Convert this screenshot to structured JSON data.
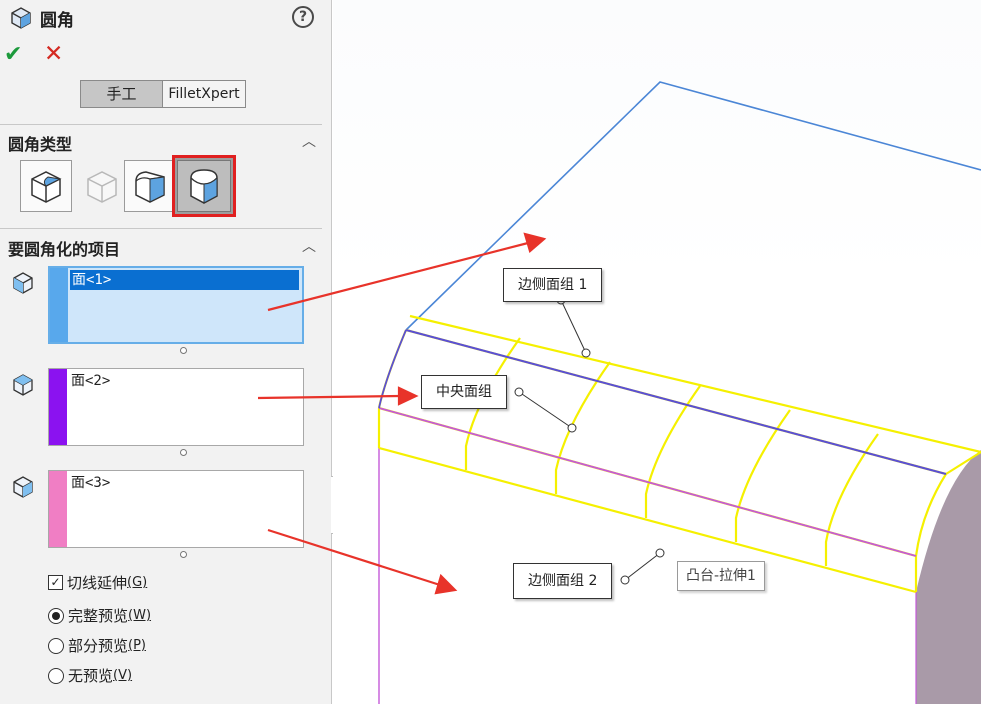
{
  "header": {
    "title": "圆角",
    "help_glyph": "?"
  },
  "actions": {
    "ok_glyph": "✔",
    "cancel_glyph": "✕"
  },
  "tabs": [
    {
      "label": "手工",
      "selected": true
    },
    {
      "label": "FilletXpert",
      "selected": false
    }
  ],
  "fillet_type": {
    "title": "圆角类型",
    "collapse_glyph": "︿",
    "options": [
      {
        "name": "constant-size-fillet",
        "selected": false
      },
      {
        "name": "variable-size-fillet",
        "selected": false,
        "disabled": true
      },
      {
        "name": "face-fillet",
        "selected": false
      },
      {
        "name": "full-round-fillet",
        "selected": true
      }
    ]
  },
  "items": {
    "title": "要圆角化的项目",
    "collapse_glyph": "︿",
    "selections": [
      {
        "value": "面<1>",
        "color": "#58a8ec",
        "active": true
      },
      {
        "value": "面<2>",
        "color": "#8b12f0",
        "active": false
      },
      {
        "value": "面<3>",
        "color": "#f07ec4",
        "active": false
      }
    ]
  },
  "options": {
    "tangent_propagation": {
      "label": "切线延伸",
      "hotkey": "(G)",
      "checked": true,
      "check_glyph": "✓"
    },
    "preview_modes": [
      {
        "label": "完整预览",
        "hotkey": "(W)",
        "selected": true
      },
      {
        "label": "部分预览",
        "hotkey": "(P)",
        "selected": false
      },
      {
        "label": "无预览",
        "hotkey": "(V)",
        "selected": false
      }
    ]
  },
  "viewport": {
    "callouts": {
      "side1": "边侧面组 1",
      "center": "中央面组",
      "side2": "边侧面组 2"
    },
    "feature_tag": "凸台-拉伸1",
    "colors": {
      "arrow": "#e8332a",
      "preview": "#f5f000",
      "edge_blue": "#4b86d6",
      "edge_violet": "#5a4fd6",
      "edge_magenta": "#c45ad8",
      "side_face": "#a99aa8"
    }
  }
}
